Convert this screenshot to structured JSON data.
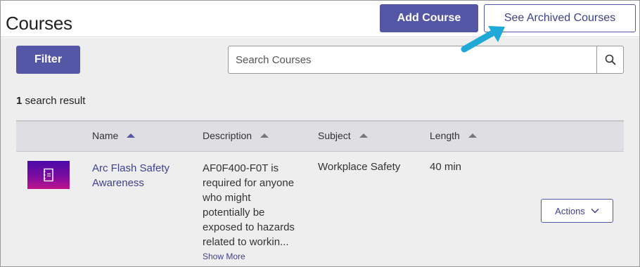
{
  "header": {
    "title": "Courses",
    "add_course_label": "Add Course",
    "archived_label": "See Archived Courses"
  },
  "toolbar": {
    "filter_label": "Filter",
    "search_placeholder": "Search Courses",
    "search_icon": "search-icon"
  },
  "results": {
    "count": "1",
    "count_suffix": " search result"
  },
  "table": {
    "columns": [
      {
        "label": "Name",
        "sort": "ascending"
      },
      {
        "label": "Description",
        "sort": "ascending"
      },
      {
        "label": "Subject",
        "sort": "ascending"
      },
      {
        "label": "Length",
        "sort": "ascending"
      }
    ],
    "rows": [
      {
        "thumbnail_icon": "course-notebook-icon",
        "name": "Arc Flash Safety Awareness",
        "description": "AF0F400-F0T is required for anyone who might potentially be exposed to hazards related to workin...",
        "show_more_label": "Show More",
        "subject": "Workplace Safety",
        "length": "40 min",
        "actions_label": "Actions",
        "actions_icon": "chevron-down-icon"
      }
    ]
  },
  "colors": {
    "brand": "#5457a6",
    "link": "#3e418f",
    "pointer": "#1fa9d6"
  }
}
